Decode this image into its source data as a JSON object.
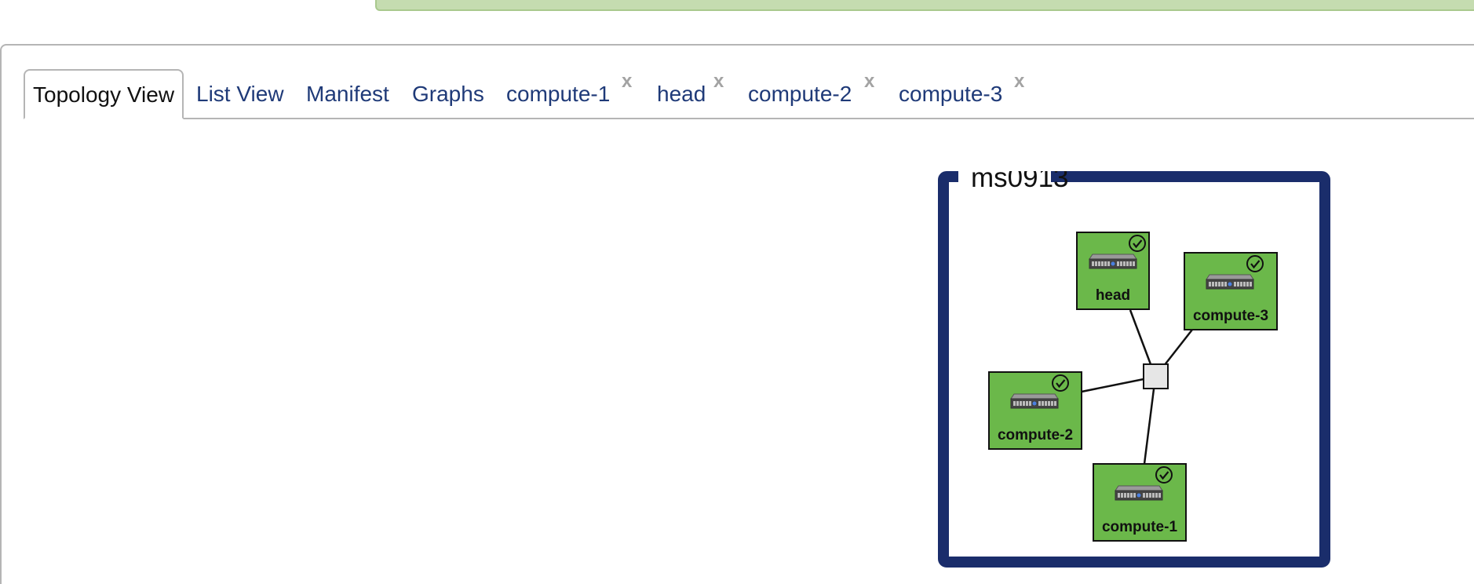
{
  "tabs": [
    {
      "label": "Topology View",
      "active": true,
      "closable": false
    },
    {
      "label": "List View",
      "active": false,
      "closable": false
    },
    {
      "label": "Manifest",
      "active": false,
      "closable": false
    },
    {
      "label": "Graphs",
      "active": false,
      "closable": false
    },
    {
      "label": "compute-1",
      "active": false,
      "closable": true
    },
    {
      "label": "head",
      "active": false,
      "closable": true
    },
    {
      "label": "compute-2",
      "active": false,
      "closable": true
    },
    {
      "label": "compute-3",
      "active": false,
      "closable": true
    }
  ],
  "close_glyph": "x",
  "topology": {
    "slice_name": "ms0913",
    "nodes": [
      {
        "label": "head",
        "status": "ready",
        "icon": "server-icon"
      },
      {
        "label": "compute-3",
        "status": "ready",
        "icon": "server-icon"
      },
      {
        "label": "compute-2",
        "status": "ready",
        "icon": "server-icon"
      },
      {
        "label": "compute-1",
        "status": "ready",
        "icon": "server-icon"
      }
    ],
    "link_hub": "lan-switch"
  },
  "colors": {
    "tab_text": "#1f3a78",
    "slice_border": "#1a2d6b",
    "node_fill": "#6bb84a",
    "status_bar": "#c5dcb0",
    "hub_fill": "#e6e6e6"
  }
}
